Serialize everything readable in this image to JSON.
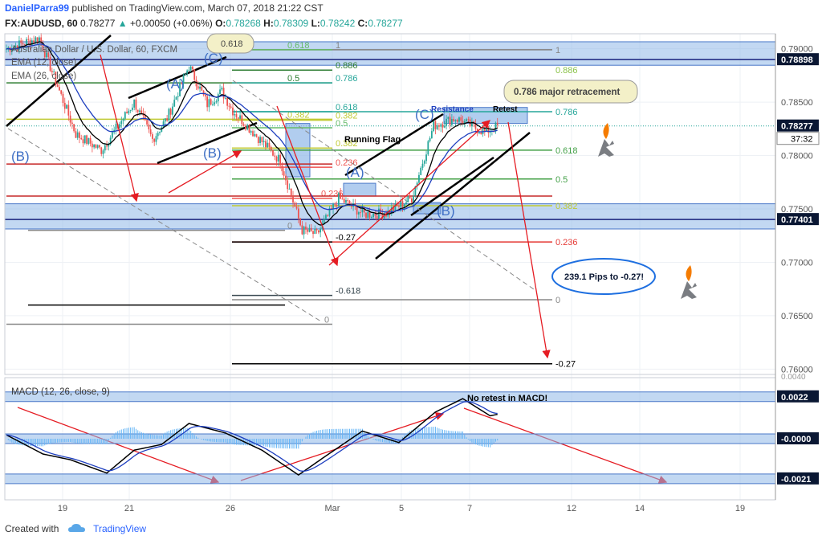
{
  "header": {
    "user": "DanielParra99",
    "published_text": "published on TradingView.com, March 07, 2018 21:22 CST",
    "symbol": "FX:AUDUSD, 60",
    "last": "0.78277",
    "change": "+0.00050 (+0.06%)",
    "o_label": "O:",
    "o": "0.78268",
    "h_label": "H:",
    "h": "0.78309",
    "l_label": "L:",
    "l": "0.78242",
    "c_label": "C:",
    "c": "0.78277"
  },
  "legend": {
    "title": "Australian Dollar / U.S. Dollar, 60, FXCM",
    "ema12": "EMA (12, close)",
    "ema26": "EMA (26, close)"
  },
  "macd_legend": "MACD (12, 26, close, 9)",
  "footer": {
    "created_with": "Created with",
    "brand": "TradingView"
  },
  "colors": {
    "up": "#26a69a",
    "down": "#ef5350",
    "ema_fast": "#000000",
    "ema_slow": "#1e3fbf",
    "zone_fill": "#90b8e8",
    "zone_stroke": "#4a78c8",
    "arrow": "#e51c23"
  },
  "chart_data": [
    {
      "type": "candlestick",
      "title": "Australian Dollar / U.S. Dollar, 60, FXCM",
      "ylim": [
        0.7595,
        0.7914
      ],
      "x_tick_labels": [
        "19",
        "21",
        "26",
        "Mar",
        "5",
        "7",
        "12",
        "14",
        "19"
      ],
      "y_tick_labels": [
        "0.79000",
        "0.78500",
        "0.78000",
        "0.77500",
        "0.77000",
        "0.76500",
        "0.76000"
      ],
      "price_labels": [
        {
          "text": "0.78898",
          "value": 0.78898
        },
        {
          "text": "0.78277",
          "value": 0.78277,
          "sub": "37:32"
        },
        {
          "text": "0.77401",
          "value": 0.77401
        }
      ],
      "key_points": [
        {
          "t": 0,
          "price": 0.79
        },
        {
          "t": 18,
          "price": 0.791
        },
        {
          "t": 38,
          "price": 0.782
        },
        {
          "t": 52,
          "price": 0.7805
        },
        {
          "t": 70,
          "price": 0.785
        },
        {
          "t": 80,
          "price": 0.7815
        },
        {
          "t": 88,
          "price": 0.7835
        },
        {
          "t": 100,
          "price": 0.7884
        },
        {
          "t": 110,
          "price": 0.7848
        },
        {
          "t": 118,
          "price": 0.786
        },
        {
          "t": 124,
          "price": 0.7842
        },
        {
          "t": 135,
          "price": 0.7822
        },
        {
          "t": 150,
          "price": 0.7795
        },
        {
          "t": 162,
          "price": 0.773
        },
        {
          "t": 170,
          "price": 0.7726
        },
        {
          "t": 182,
          "price": 0.776
        },
        {
          "t": 196,
          "price": 0.7745
        },
        {
          "t": 208,
          "price": 0.7746
        },
        {
          "t": 222,
          "price": 0.776
        },
        {
          "t": 234,
          "price": 0.7828
        },
        {
          "t": 246,
          "price": 0.7835
        },
        {
          "t": 262,
          "price": 0.7822
        },
        {
          "t": 270,
          "price": 0.7828
        }
      ],
      "annotations": [
        "Running Flag",
        "Resistance",
        "Retest",
        "0.786 major retracement",
        "239.1 Pips to -0.27!",
        "(A)",
        "(B)",
        "(C)",
        "0.618",
        "0.886",
        "0.786",
        "0.5",
        "0.382",
        "0.236",
        "0",
        "-0.27",
        "-0.618",
        "1"
      ]
    },
    {
      "type": "line",
      "title": "MACD (12, 26, close, 9)",
      "price_labels": [
        {
          "text": "0.0022",
          "value": 0.0022
        },
        {
          "text": "-0.0000",
          "value": 0.0
        },
        {
          "text": "-0.0021",
          "value": -0.0021
        }
      ],
      "annotation": "No retest in MACD!",
      "macd_points": [
        {
          "t": 0,
          "v": 0.0002
        },
        {
          "t": 20,
          "v": -0.0008
        },
        {
          "t": 35,
          "v": -0.0011
        },
        {
          "t": 55,
          "v": -0.0018
        },
        {
          "t": 70,
          "v": -0.0006
        },
        {
          "t": 85,
          "v": -0.0003
        },
        {
          "t": 100,
          "v": 0.0008
        },
        {
          "t": 120,
          "v": 0.0003
        },
        {
          "t": 140,
          "v": -0.0006
        },
        {
          "t": 160,
          "v": -0.0019
        },
        {
          "t": 175,
          "v": -0.0009
        },
        {
          "t": 195,
          "v": 0.0004
        },
        {
          "t": 215,
          "v": -0.0002
        },
        {
          "t": 235,
          "v": 0.0014
        },
        {
          "t": 250,
          "v": 0.0021
        },
        {
          "t": 265,
          "v": 0.0012
        },
        {
          "t": 270,
          "v": 0.0013
        }
      ]
    }
  ]
}
